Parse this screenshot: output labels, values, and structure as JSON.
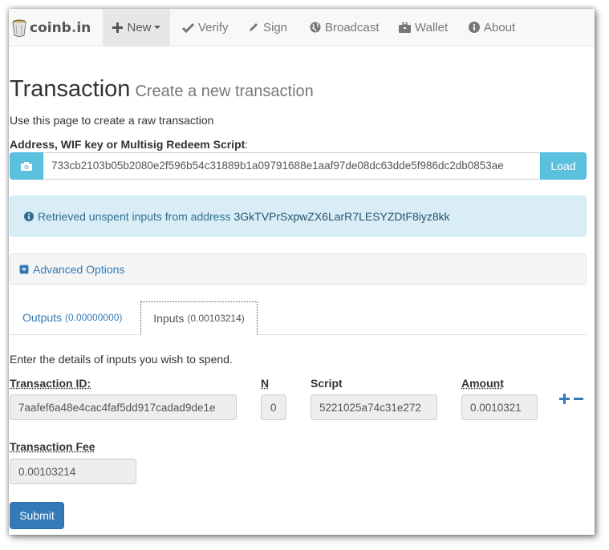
{
  "nav": {
    "brand": "coinb",
    "brand_dot": ".",
    "brand_tld": "in",
    "items": [
      {
        "label": "New",
        "icon": "plus-icon"
      },
      {
        "label": "Verify",
        "icon": "check-icon"
      },
      {
        "label": "Sign",
        "icon": "pencil-icon"
      },
      {
        "label": "Broadcast",
        "icon": "globe-icon"
      },
      {
        "label": "Wallet",
        "icon": "briefcase-icon"
      },
      {
        "label": "About",
        "icon": "info-icon"
      }
    ]
  },
  "page": {
    "title": "Transaction",
    "subtitle": "Create a new transaction",
    "lead": "Use this page to create a raw transaction"
  },
  "address": {
    "label": "Address, WIF key or Multisig Redeem Script",
    "label_suffix": ":",
    "value": "733cb2103b05b2080e2f596b54c31889b1a09791688e1aaf97de08dc63dde5f986dc2db0853ae",
    "load_label": "Load"
  },
  "alert": {
    "text": "Retrieved unspent inputs from address",
    "address": "3GkTVPrSxpwZX6LarR7LESYZDtF8iyz8kk"
  },
  "advanced": {
    "label": "Advanced Options"
  },
  "tabs": {
    "outputs_label": "Outputs",
    "outputs_amount": "(0.00000000)",
    "inputs_label": "Inputs",
    "inputs_amount": "(0.00103214)"
  },
  "inputs": {
    "description": "Enter the details of inputs you wish to spend.",
    "col_txid": "Transaction ID:",
    "col_n": "N",
    "col_script": "Script",
    "col_amount": "Amount",
    "txid": "7aafef6a48e4cac4faf5dd917cadad9de1e",
    "n": "0",
    "script": "5221025a74c31e272",
    "amount": "0.0010321",
    "fee_label": "Transaction Fee",
    "fee": "0.00103214"
  },
  "submit_label": "Submit",
  "colors": {
    "primary": "#337ab7",
    "info": "#5bc0de",
    "alert_bg": "#d9edf7",
    "alert_text": "#31708f"
  }
}
